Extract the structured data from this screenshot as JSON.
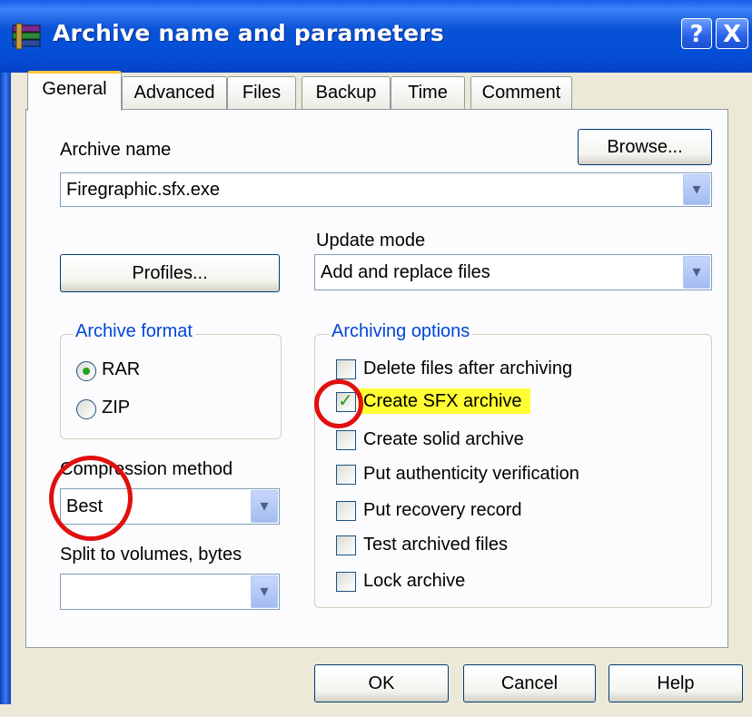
{
  "window": {
    "title": "Archive name and parameters",
    "help_glyph": "?",
    "close_glyph": "X",
    "title_icon": "winrar-books-icon"
  },
  "tabs": [
    {
      "label": "General",
      "active": true
    },
    {
      "label": "Advanced",
      "active": false
    },
    {
      "label": "Files",
      "active": false
    },
    {
      "label": "Backup",
      "active": false
    },
    {
      "label": "Time",
      "active": false
    },
    {
      "label": "Comment",
      "active": false
    }
  ],
  "general": {
    "archive_name_label": "Archive name",
    "browse_label": "Browse...",
    "archive_name_value": "Firegraphic.sfx.exe",
    "update_mode_label": "Update mode",
    "update_mode_value": "Add and replace files",
    "profiles_label": "Profiles...",
    "archive_format": {
      "title": "Archive format",
      "options": [
        {
          "label": "RAR",
          "selected": true
        },
        {
          "label": "ZIP",
          "selected": false
        }
      ]
    },
    "archiving_options": {
      "title": "Archiving options",
      "items": [
        {
          "label": "Delete files after archiving",
          "checked": false
        },
        {
          "label": "Create SFX archive",
          "checked": true,
          "highlighted": true
        },
        {
          "label": "Create solid archive",
          "checked": false
        },
        {
          "label": "Put authenticity verification",
          "checked": false
        },
        {
          "label": "Put recovery record",
          "checked": false
        },
        {
          "label": "Test archived files",
          "checked": false
        },
        {
          "label": "Lock archive",
          "checked": false
        }
      ]
    },
    "compression_method_label": "Compression method",
    "compression_method_value": "Best",
    "split_label": "Split to volumes, bytes",
    "split_value": ""
  },
  "footer": {
    "ok_label": "OK",
    "cancel_label": "Cancel",
    "help_label": "Help"
  },
  "colors": {
    "highlight": "#ffff33",
    "annotation_circle": "#e01010",
    "group_title": "#0046d5",
    "check_green": "#21a121"
  }
}
